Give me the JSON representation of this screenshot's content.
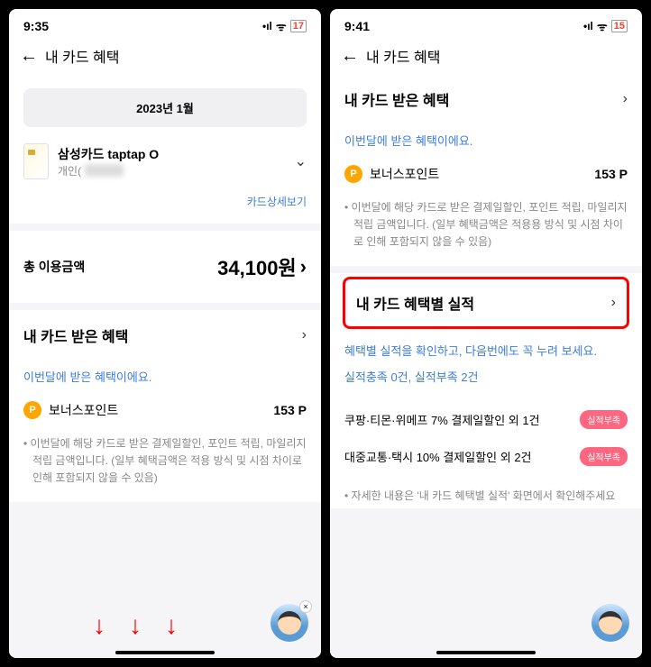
{
  "left": {
    "status": {
      "time": "9:35",
      "battery": "17"
    },
    "nav_title": "내 카드 혜택",
    "month": "2023년 1월",
    "card": {
      "name": "삼성카드 taptap O",
      "sub": "개인("
    },
    "detail_link": "카드상세보기",
    "amount": {
      "label": "총 이용금액",
      "value": "34,100원"
    },
    "benefits": {
      "title": "내 카드 받은 혜택",
      "subtitle": "이번달에 받은 혜택이에요.",
      "point_label": "보너스포인트",
      "point_value": "153 P"
    },
    "note": "이번달에 해당 카드로 받은 결제일할인, 포인트 적립, 마일리지 적립 금액입니다. (일부 혜택금액은 적용 방식 및 시점 차이로 인해 포함되지 않을 수 있음)"
  },
  "right": {
    "status": {
      "time": "9:41",
      "battery": "15"
    },
    "nav_title": "내 카드 혜택",
    "benefits": {
      "title": "내 카드 받은 혜택",
      "subtitle": "이번달에 받은 혜택이에요.",
      "point_label": "보너스포인트",
      "point_value": "153 P"
    },
    "note": "이번달에 해당 카드로 받은 결제일할인, 포인트 적립, 마일리지 적립 금액입니다. (일부 혜택금액은 적용용 방식 및 시점 차이로 인해 포함되지 않을 수 있음)",
    "perf": {
      "title": "내 카드 혜택별 실적",
      "desc": "혜택별 실적을 확인하고, 다음번에도 꼭 누려 보세요.",
      "summary": "실적충족 0건, 실적부족 2건",
      "items": [
        {
          "label": "쿠팡·티몬·위메프 7% 결제일할인 외 1건",
          "status": "실적부족"
        },
        {
          "label": "대중교통·택시 10% 결제일할인 외 2건",
          "status": "실적부족"
        }
      ],
      "footer": "자세한 내용은 '내 카드 혜택별 실적' 화면에서 확인해주세요"
    }
  }
}
